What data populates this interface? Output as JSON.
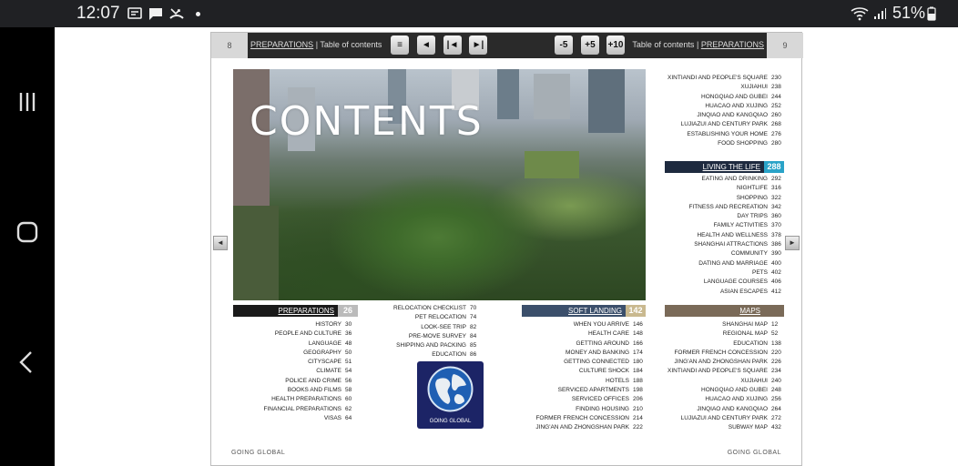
{
  "status_bar": {
    "time": "12:07",
    "battery": "51%",
    "icons": [
      "sim-card-icon",
      "chat-bubble-icon",
      "missed-call-icon",
      "wifi-icon",
      "signal-icon",
      "battery-icon"
    ]
  },
  "nav": {
    "icons": [
      "recent-apps-icon",
      "home-icon",
      "back-icon"
    ]
  },
  "reader": {
    "left_page_num": "8",
    "right_page_num": "9",
    "left_crumb_section": "PREPARATIONS",
    "left_crumb_sep": "|",
    "left_crumb_sub": "Table of contents",
    "right_crumb_sub": "Table of contents",
    "right_crumb_sep": "|",
    "right_crumb_section": "PREPARATIONS",
    "buttons": {
      "menu": "≡",
      "back": "◄",
      "first": "|◄",
      "last": "►|",
      "minus5": "-5",
      "plus5": "+5",
      "plus10": "+10"
    },
    "footer_left": "GOING GLOBAL",
    "footer_right": "GOING GLOBAL"
  },
  "hero": {
    "title": "CONTENTS"
  },
  "logo": {
    "text": "GOING GLOBAL"
  },
  "sections": {
    "preparations": {
      "label": "PREPARATIONS",
      "page": "26",
      "color": "#1a1a1a",
      "items": [
        [
          "HISTORY",
          "30"
        ],
        [
          "PEOPLE AND CULTURE",
          "36"
        ],
        [
          "LANGUAGE",
          "48"
        ],
        [
          "GEOGRAPHY",
          "50"
        ],
        [
          "CITYSCAPE",
          "51"
        ],
        [
          "CLIMATE",
          "54"
        ],
        [
          "POLICE AND CRIME",
          "56"
        ],
        [
          "BOOKS AND FILMS",
          "58"
        ],
        [
          "HEALTH PREPARATIONS",
          "60"
        ],
        [
          "FINANCIAL PREPARATIONS",
          "62"
        ],
        [
          "VISAS",
          "64"
        ]
      ]
    },
    "preparations_cont": {
      "items": [
        [
          "RELOCATION CHECKLIST",
          "70"
        ],
        [
          "PET RELOCATION",
          "74"
        ],
        [
          "LOOK-SEE TRIP",
          "82"
        ],
        [
          "PRE-MOVE SURVEY",
          "84"
        ],
        [
          "SHIPPING AND PACKING",
          "85"
        ],
        [
          "EDUCATION",
          "86"
        ]
      ]
    },
    "soft_landing": {
      "label": "SOFT LANDING",
      "page": "142",
      "color": "#3b4f6b",
      "items": [
        [
          "WHEN YOU ARRIVE",
          "146"
        ],
        [
          "HEALTH CARE",
          "148"
        ],
        [
          "GETTING AROUND",
          "166"
        ],
        [
          "MONEY AND BANKING",
          "174"
        ],
        [
          "GETTING CONNECTED",
          "180"
        ],
        [
          "CULTURE SHOCK",
          "184"
        ],
        [
          "HOTELS",
          "188"
        ],
        [
          "SERVICED APARTMENTS",
          "198"
        ],
        [
          "SERVICED OFFICES",
          "206"
        ],
        [
          "FINDING HOUSING",
          "210"
        ],
        [
          "FORMER FRENCH CONCESSION",
          "214"
        ],
        [
          "JING'AN AND ZHONGSHAN PARK",
          "222"
        ]
      ]
    },
    "housing_cont": {
      "items": [
        [
          "XINTIANDI AND PEOPLE'S SQUARE",
          "230"
        ],
        [
          "XUJIAHUI",
          "238"
        ],
        [
          "HONGQIAO AND GUBEI",
          "244"
        ],
        [
          "HUACAO AND XUJING",
          "252"
        ],
        [
          "JINQIAO AND KANGQIAO",
          "260"
        ],
        [
          "LUJIAZUI AND CENTURY PARK",
          "268"
        ],
        [
          "ESTABLISHING YOUR HOME",
          "276"
        ],
        [
          "FOOD SHOPPING",
          "280"
        ]
      ]
    },
    "living_the_life": {
      "label": "LIVING THE LIFE",
      "page": "288",
      "color": "#1e2a3f",
      "items": [
        [
          "EATING AND DRINKING",
          "292"
        ],
        [
          "NIGHTLIFE",
          "316"
        ],
        [
          "SHOPPING",
          "322"
        ],
        [
          "FITNESS AND RECREATION",
          "342"
        ],
        [
          "DAY TRIPS",
          "360"
        ],
        [
          "FAMILY ACTIVITIES",
          "370"
        ],
        [
          "HEALTH AND WELLNESS",
          "378"
        ],
        [
          "SHANGHAI ATTRACTIONS",
          "386"
        ],
        [
          "COMMUNITY",
          "390"
        ],
        [
          "DATING AND MARRIAGE",
          "400"
        ],
        [
          "PETS",
          "402"
        ],
        [
          "LANGUAGE COURSES",
          "406"
        ],
        [
          "ASIAN ESCAPES",
          "412"
        ]
      ]
    },
    "maps": {
      "label": "MAPS",
      "page": "",
      "color": "#7a6a58",
      "items": [
        [
          "SHANGHAI MAP",
          "12"
        ],
        [
          "REGIONAL MAP",
          "52"
        ],
        [
          "EDUCATION",
          "138"
        ],
        [
          "FORMER FRENCH CONCESSION",
          "220"
        ],
        [
          "JING'AN AND ZHONGSHAN PARK",
          "226"
        ],
        [
          "XINTIANDI AND PEOPLE'S SQUARE",
          "234"
        ],
        [
          "XUJIAHUI",
          "240"
        ],
        [
          "HONGQIAO AND GUBEI",
          "248"
        ],
        [
          "HUACAO AND XUJING",
          "256"
        ],
        [
          "JINQIAO AND KANGQIAO",
          "264"
        ],
        [
          "LUJIAZUI AND CENTURY PARK",
          "272"
        ],
        [
          "SUBWAY MAP",
          "432"
        ]
      ]
    }
  },
  "colors": {
    "soft_landing_num_bg": "#c9b98f",
    "living_num_bg": "#2aa3c8",
    "prep_num_bg": "#bbbbbb",
    "maps_num_bg": "#bfb3a3"
  }
}
